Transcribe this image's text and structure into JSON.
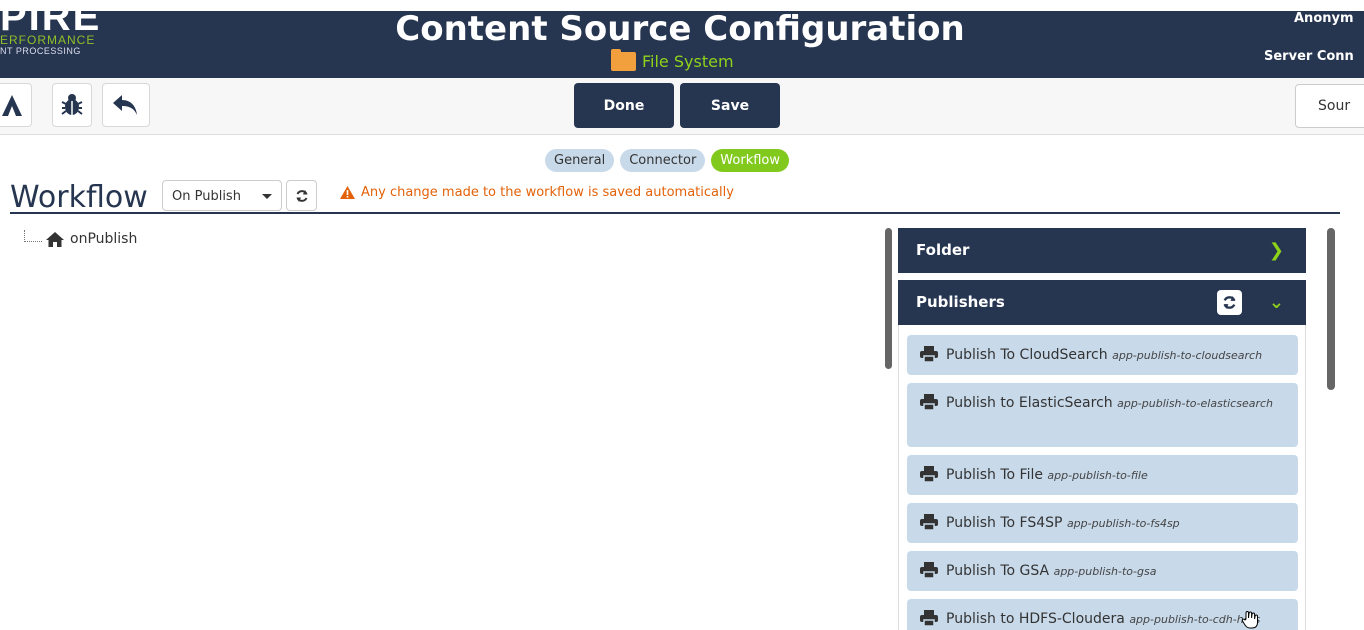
{
  "header": {
    "brand_big": "PIRE",
    "brand_line1": "ERFORMANCE",
    "brand_line2": "NT PROCESSING",
    "title": "Content Source Configuration",
    "source_type": "File System",
    "user": "Anonym",
    "server_status": "Server Conn"
  },
  "toolbar": {
    "done_label": "Done",
    "save_label": "Save",
    "sources_label": "Sour"
  },
  "tabs": [
    {
      "label": "General",
      "active": false
    },
    {
      "label": "Connector",
      "active": false
    },
    {
      "label": "Workflow",
      "active": true
    }
  ],
  "workflow": {
    "title": "Workflow",
    "stage_selected": "On Publish",
    "warning": "Any change made to the workflow is saved automatically",
    "tree_root": "onPublish"
  },
  "panel": {
    "folder_label": "Folder",
    "publishers_label": "Publishers",
    "publishers": [
      {
        "name": "Publish To CloudSearch",
        "id": "app-publish-to-cloudsearch"
      },
      {
        "name": "Publish to ElasticSearch",
        "id": "app-publish-to-elasticsearch"
      },
      {
        "name": "Publish To File",
        "id": "app-publish-to-file"
      },
      {
        "name": "Publish To FS4SP",
        "id": "app-publish-to-fs4sp"
      },
      {
        "name": "Publish To GSA",
        "id": "app-publish-to-gsa"
      },
      {
        "name": "Publish to HDFS-Cloudera",
        "id": "app-publish-to-cdh-hdfs"
      }
    ]
  },
  "colors": {
    "navy": "#263550",
    "accent_green": "#82c91e",
    "tab_blue": "#c8d9ea",
    "warning_orange": "#e36209",
    "folder_orange": "#f2a03d"
  }
}
